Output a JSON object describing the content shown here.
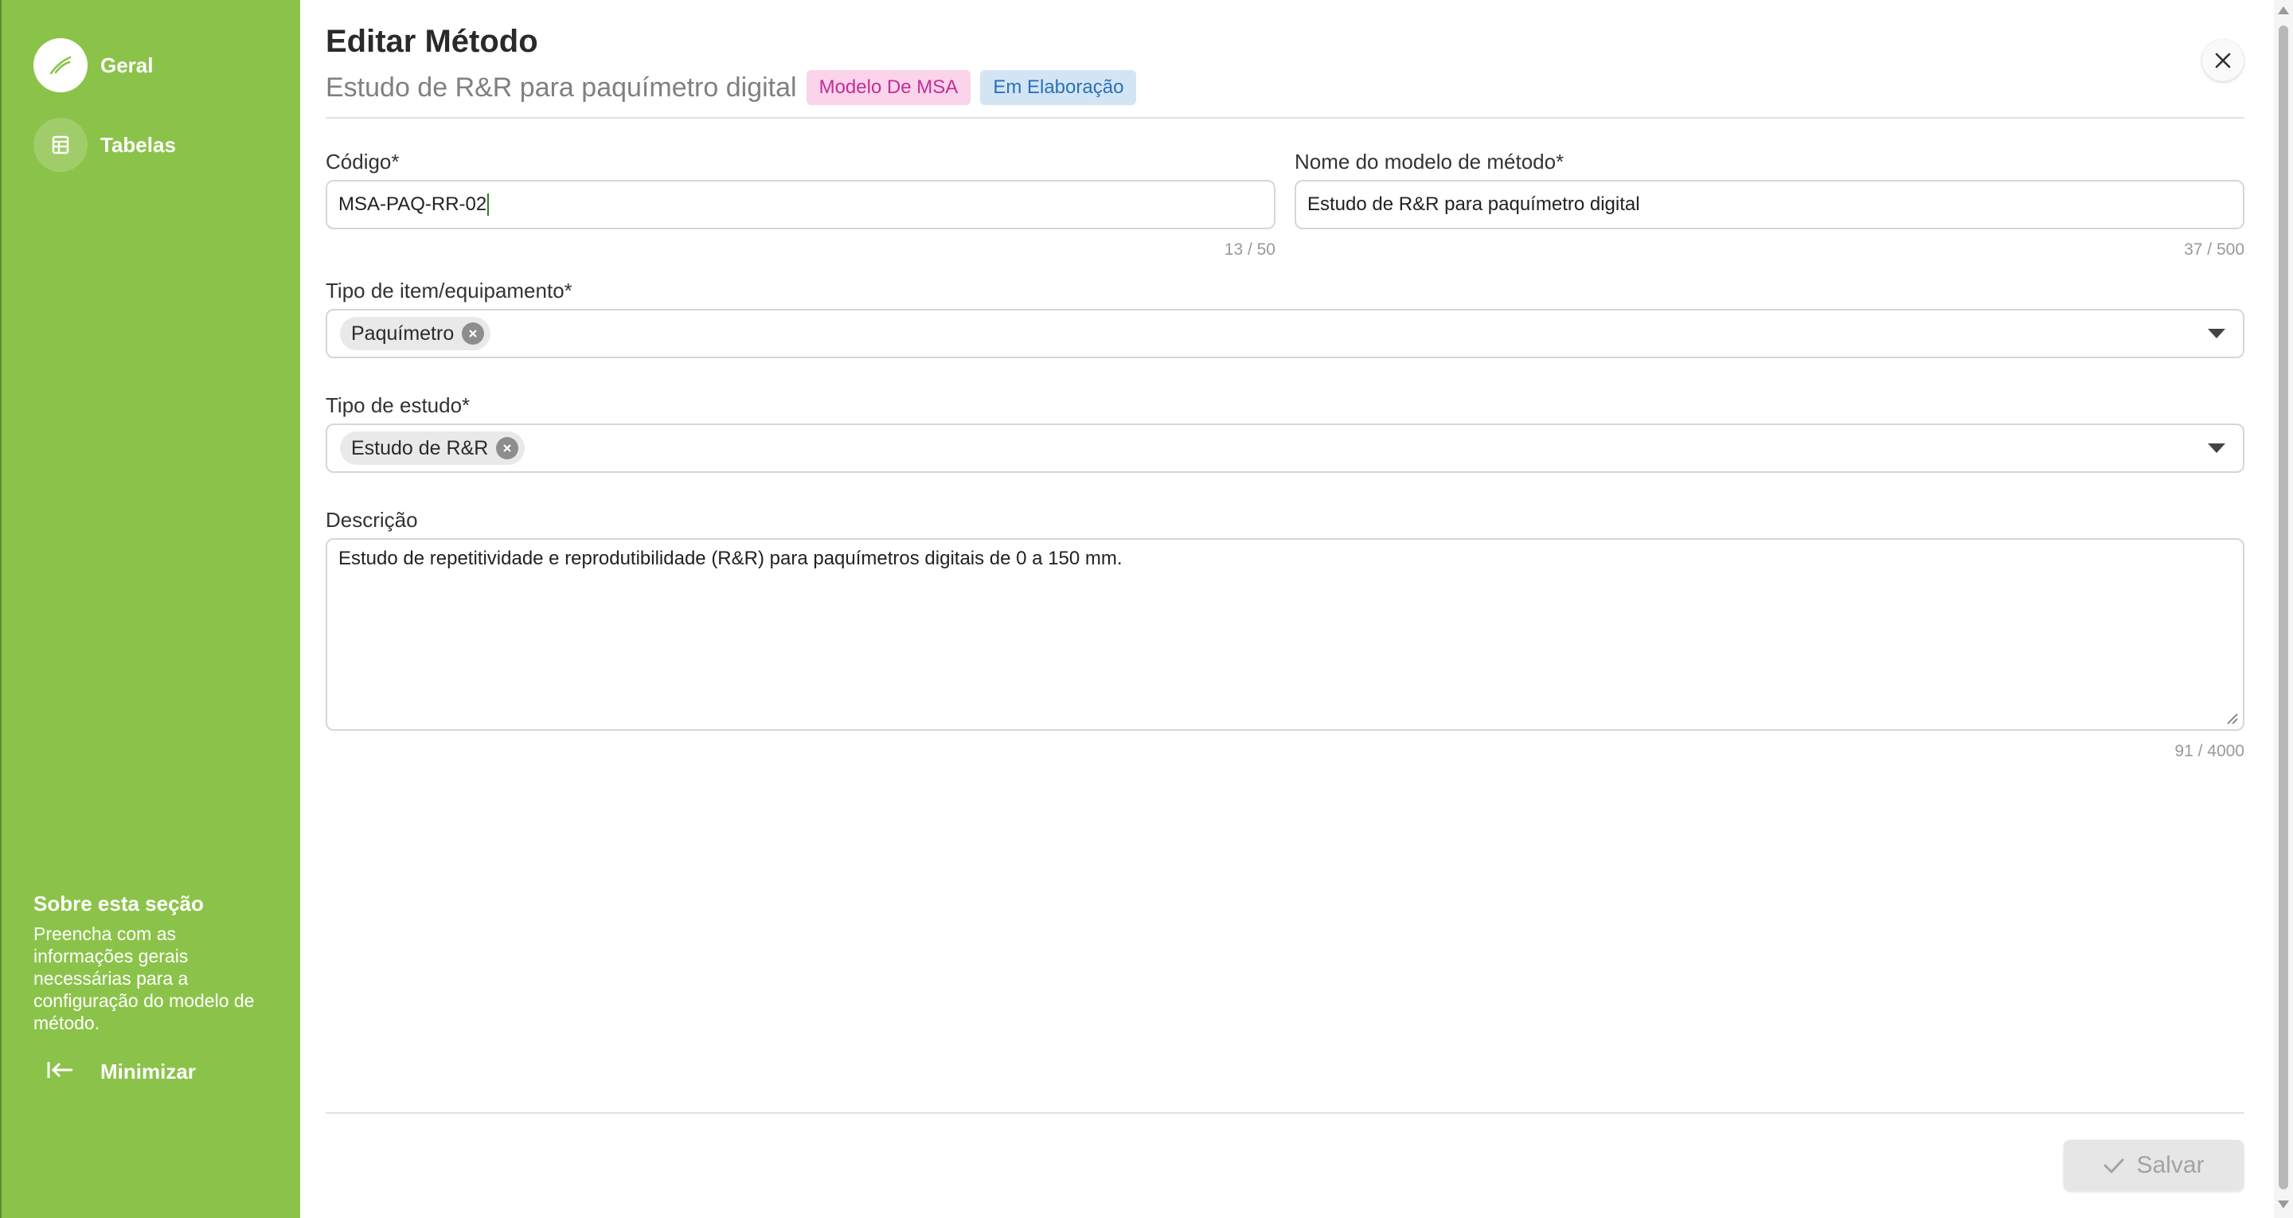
{
  "sidebar": {
    "items": [
      {
        "label": "Geral",
        "icon": "leaf-pen-icon",
        "active": true
      },
      {
        "label": "Tabelas",
        "icon": "table-icon",
        "active": false
      }
    ],
    "about_title": "Sobre esta seção",
    "about_text": "Preencha com as informações gerais necessárias para a configuração do modelo de método.",
    "minimize_label": "Minimizar"
  },
  "header": {
    "title": "Editar Método",
    "subtitle": "Estudo de R&R para paquímetro digital",
    "chips": [
      "Modelo De MSA",
      "Em Elaboração"
    ]
  },
  "form": {
    "codigo": {
      "label": "Código*",
      "value": "MSA-PAQ-RR-02",
      "counter": "13 / 50"
    },
    "nome": {
      "label": "Nome do modelo de método*",
      "value": "Estudo de R&R para paquímetro digital",
      "counter": "37 / 500"
    },
    "tipo_item": {
      "label": "Tipo de item/equipamento*",
      "tag": "Paquímetro"
    },
    "tipo_estudo": {
      "label": "Tipo de estudo*",
      "tag": "Estudo de R&R"
    },
    "descricao": {
      "label": "Descrição",
      "value": "Estudo de repetitividade e reprodutibilidade (R&R) para paquímetros digitais de 0 a 150 mm.",
      "counter": "91 / 4000"
    }
  },
  "footer": {
    "save_label": "Salvar"
  },
  "colors": {
    "sidebar": "#8bc34a",
    "chip_pink_bg": "#fbd3ea",
    "chip_blue_bg": "#d3e5f5"
  }
}
